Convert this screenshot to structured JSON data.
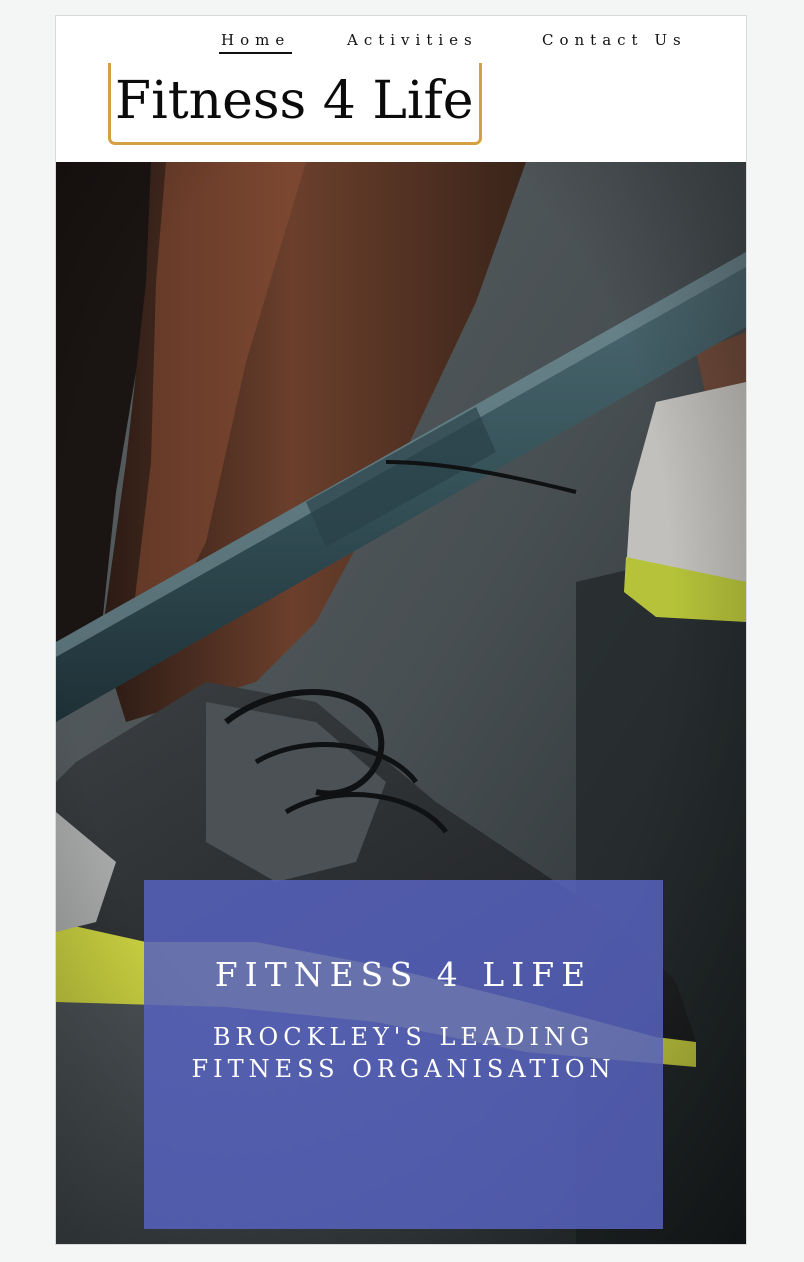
{
  "nav": {
    "items": [
      {
        "label": "Home",
        "active": true
      },
      {
        "label": "Activities",
        "active": false
      },
      {
        "label": "Contact Us",
        "active": false
      }
    ]
  },
  "logo": {
    "text": "Fitness 4 Life",
    "border_color": "#d5a042"
  },
  "hero": {
    "title": "FITNESS 4 LIFE",
    "subtitle": "BROCKLEY'S LEADING FITNESS ORGANISATION",
    "card_color": "#5662be",
    "image_description_icon": "barbell-photo"
  }
}
